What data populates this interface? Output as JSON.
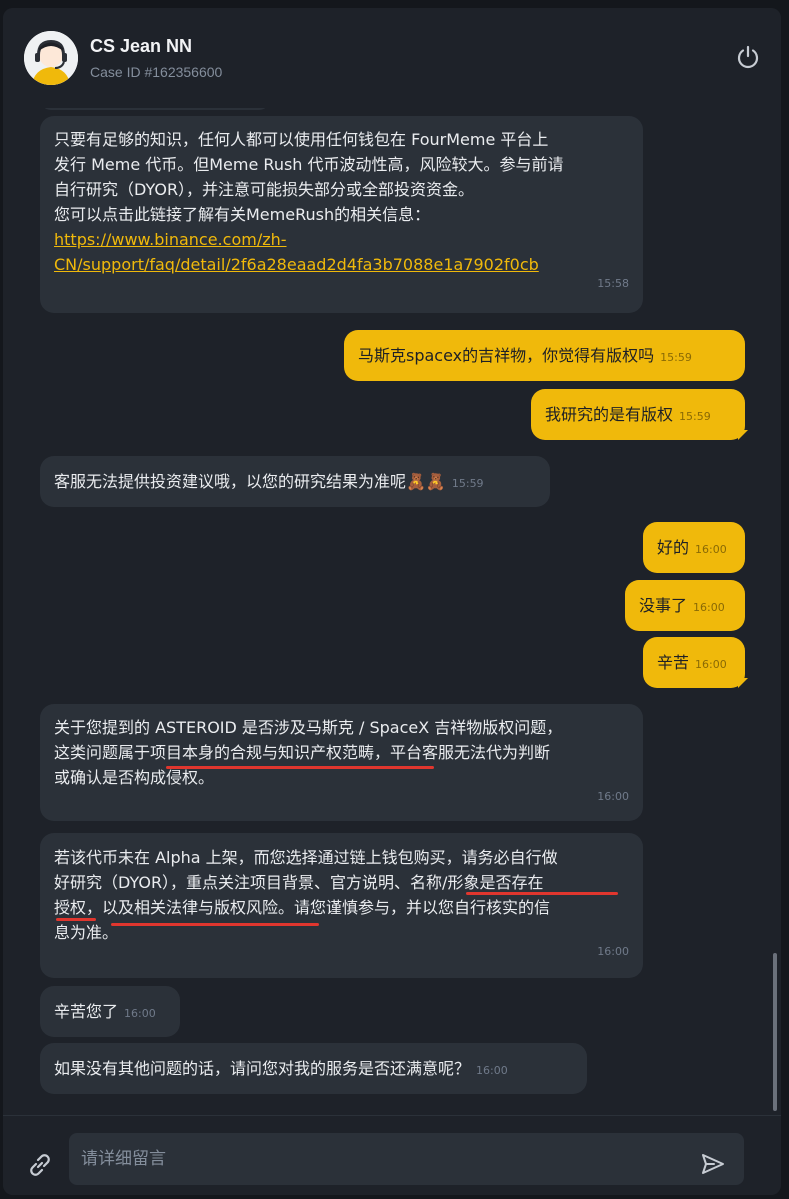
{
  "header": {
    "agent_name": "CS Jean NN",
    "case_id": "Case ID #162356600"
  },
  "messages": [
    {
      "sender": "agent",
      "lines": [
        "只要有足够的知识，任何人都可以使用任何钱包在 FourMeme 平台上",
        "发行 Meme 代币。但Meme Rush 代币波动性高，风险较大。参与前请",
        "自行研究（DYOR），并注意可能损失部分或全部投资资金。",
        "您可以点击此链接了解有关MemeRush的相关信息："
      ],
      "link_lines": [
        "https://www.binance.com/zh-",
        "CN/support/faq/detail/2f6a28eaad2d4fa3b7088e1a7902f0cb"
      ],
      "time": "15:58"
    },
    {
      "sender": "user",
      "text": "马斯克spacex的吉祥物，你觉得有版权吗",
      "time": "15:59"
    },
    {
      "sender": "user",
      "text": "我研究的是有版权",
      "time": "15:59"
    },
    {
      "sender": "agent",
      "text": "客服无法提供投资建议哦，以您的研究结果为准呢🧸🧸",
      "time": "15:59"
    },
    {
      "sender": "user",
      "text": "好的",
      "time": "16:00"
    },
    {
      "sender": "user",
      "text": "没事了",
      "time": "16:00"
    },
    {
      "sender": "user",
      "text": "辛苦",
      "time": "16:00"
    },
    {
      "sender": "agent",
      "lines": [
        "关于您提到的 ASTEROID 是否涉及马斯克 / SpaceX 吉祥物版权问题，",
        "这类问题属于项目本身的合规与知识产权范畴，平台客服无法代为判断",
        "或确认是否构成侵权。"
      ],
      "time": "16:00"
    },
    {
      "sender": "agent",
      "lines": [
        "若该代币未在 Alpha 上架，而您选择通过链上钱包购买，请务必自行做",
        "好研究（DYOR），重点关注项目背景、官方说明、名称/形象是否存在",
        "授权，以及相关法律与版权风险。请您谨慎参与，并以您自行核实的信",
        "息为准。"
      ],
      "time": "16:00"
    },
    {
      "sender": "agent",
      "text": "辛苦您了",
      "time": "16:00"
    },
    {
      "sender": "agent",
      "text": "如果没有其他问题的话，请问您对我的服务是否还满意呢？",
      "time": "16:00"
    }
  ],
  "composer": {
    "placeholder": "请详细留言"
  },
  "colors": {
    "accent": "#f0b90b",
    "agent_bubble": "#2b3139",
    "background": "#1e2229",
    "annotation_red": "#e0362e"
  }
}
